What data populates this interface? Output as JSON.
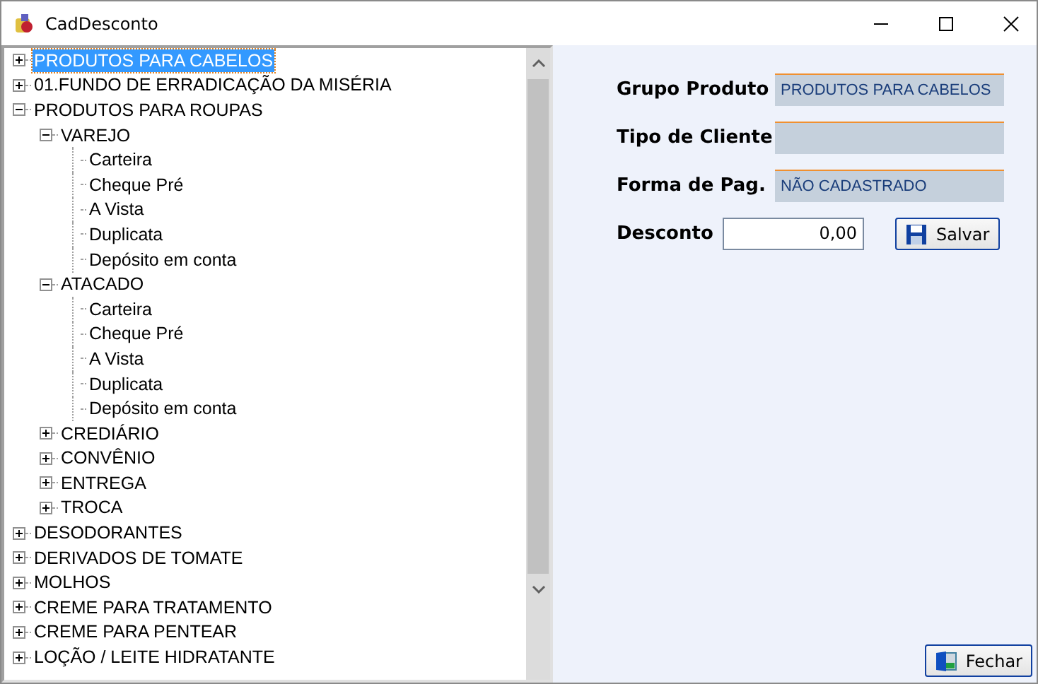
{
  "window": {
    "title": "CadDesconto"
  },
  "tree": [
    {
      "label": "PRODUTOS PARA CABELOS",
      "selected": true,
      "expanded": false
    },
    {
      "label": "01.FUNDO DE ERRADICAÇÃO DA MISÉRIA",
      "selected": false,
      "expanded": false
    },
    {
      "label": "PRODUTOS PARA ROUPAS",
      "selected": false,
      "expanded": true,
      "children": [
        {
          "label": "VAREJO",
          "selected": false,
          "expanded": true,
          "children": [
            {
              "label": "Carteira",
              "selected": false
            },
            {
              "label": "Cheque Pré",
              "selected": false
            },
            {
              "label": "A Vista",
              "selected": false
            },
            {
              "label": "Duplicata",
              "selected": false
            },
            {
              "label": "Depósito em conta",
              "selected": false
            }
          ]
        },
        {
          "label": "ATACADO",
          "selected": false,
          "expanded": true,
          "children": [
            {
              "label": "Carteira",
              "selected": false
            },
            {
              "label": "Cheque Pré",
              "selected": false
            },
            {
              "label": "A Vista",
              "selected": false
            },
            {
              "label": "Duplicata",
              "selected": false
            },
            {
              "label": "Depósito em conta",
              "selected": false
            }
          ]
        },
        {
          "label": "CREDIÁRIO",
          "selected": false,
          "expanded": false
        },
        {
          "label": "CONVÊNIO",
          "selected": false,
          "expanded": false
        },
        {
          "label": "ENTREGA",
          "selected": false,
          "expanded": false
        },
        {
          "label": "TROCA",
          "selected": false,
          "expanded": false
        }
      ]
    },
    {
      "label": "DESODORANTES",
      "selected": false,
      "expanded": false
    },
    {
      "label": "DERIVADOS DE TOMATE",
      "selected": false,
      "expanded": false
    },
    {
      "label": "MOLHOS",
      "selected": false,
      "expanded": false
    },
    {
      "label": "CREME PARA TRATAMENTO",
      "selected": false,
      "expanded": false
    },
    {
      "label": "CREME PARA PENTEAR",
      "selected": false,
      "expanded": false
    },
    {
      "label": "LOÇÃO / LEITE HIDRATANTE",
      "selected": false,
      "expanded": false
    }
  ],
  "form": {
    "fields": [
      {
        "label": "Grupo Produto",
        "value": "PRODUTOS PARA CABELOS"
      },
      {
        "label": "Tipo de Cliente"
      },
      {
        "label": "Forma de Pag.",
        "value": "NÃO CADASTRADO"
      }
    ],
    "discount": {
      "label": "Desconto",
      "value": "0,00"
    },
    "save_button": "Salvar"
  },
  "close_button": "Fechar"
}
